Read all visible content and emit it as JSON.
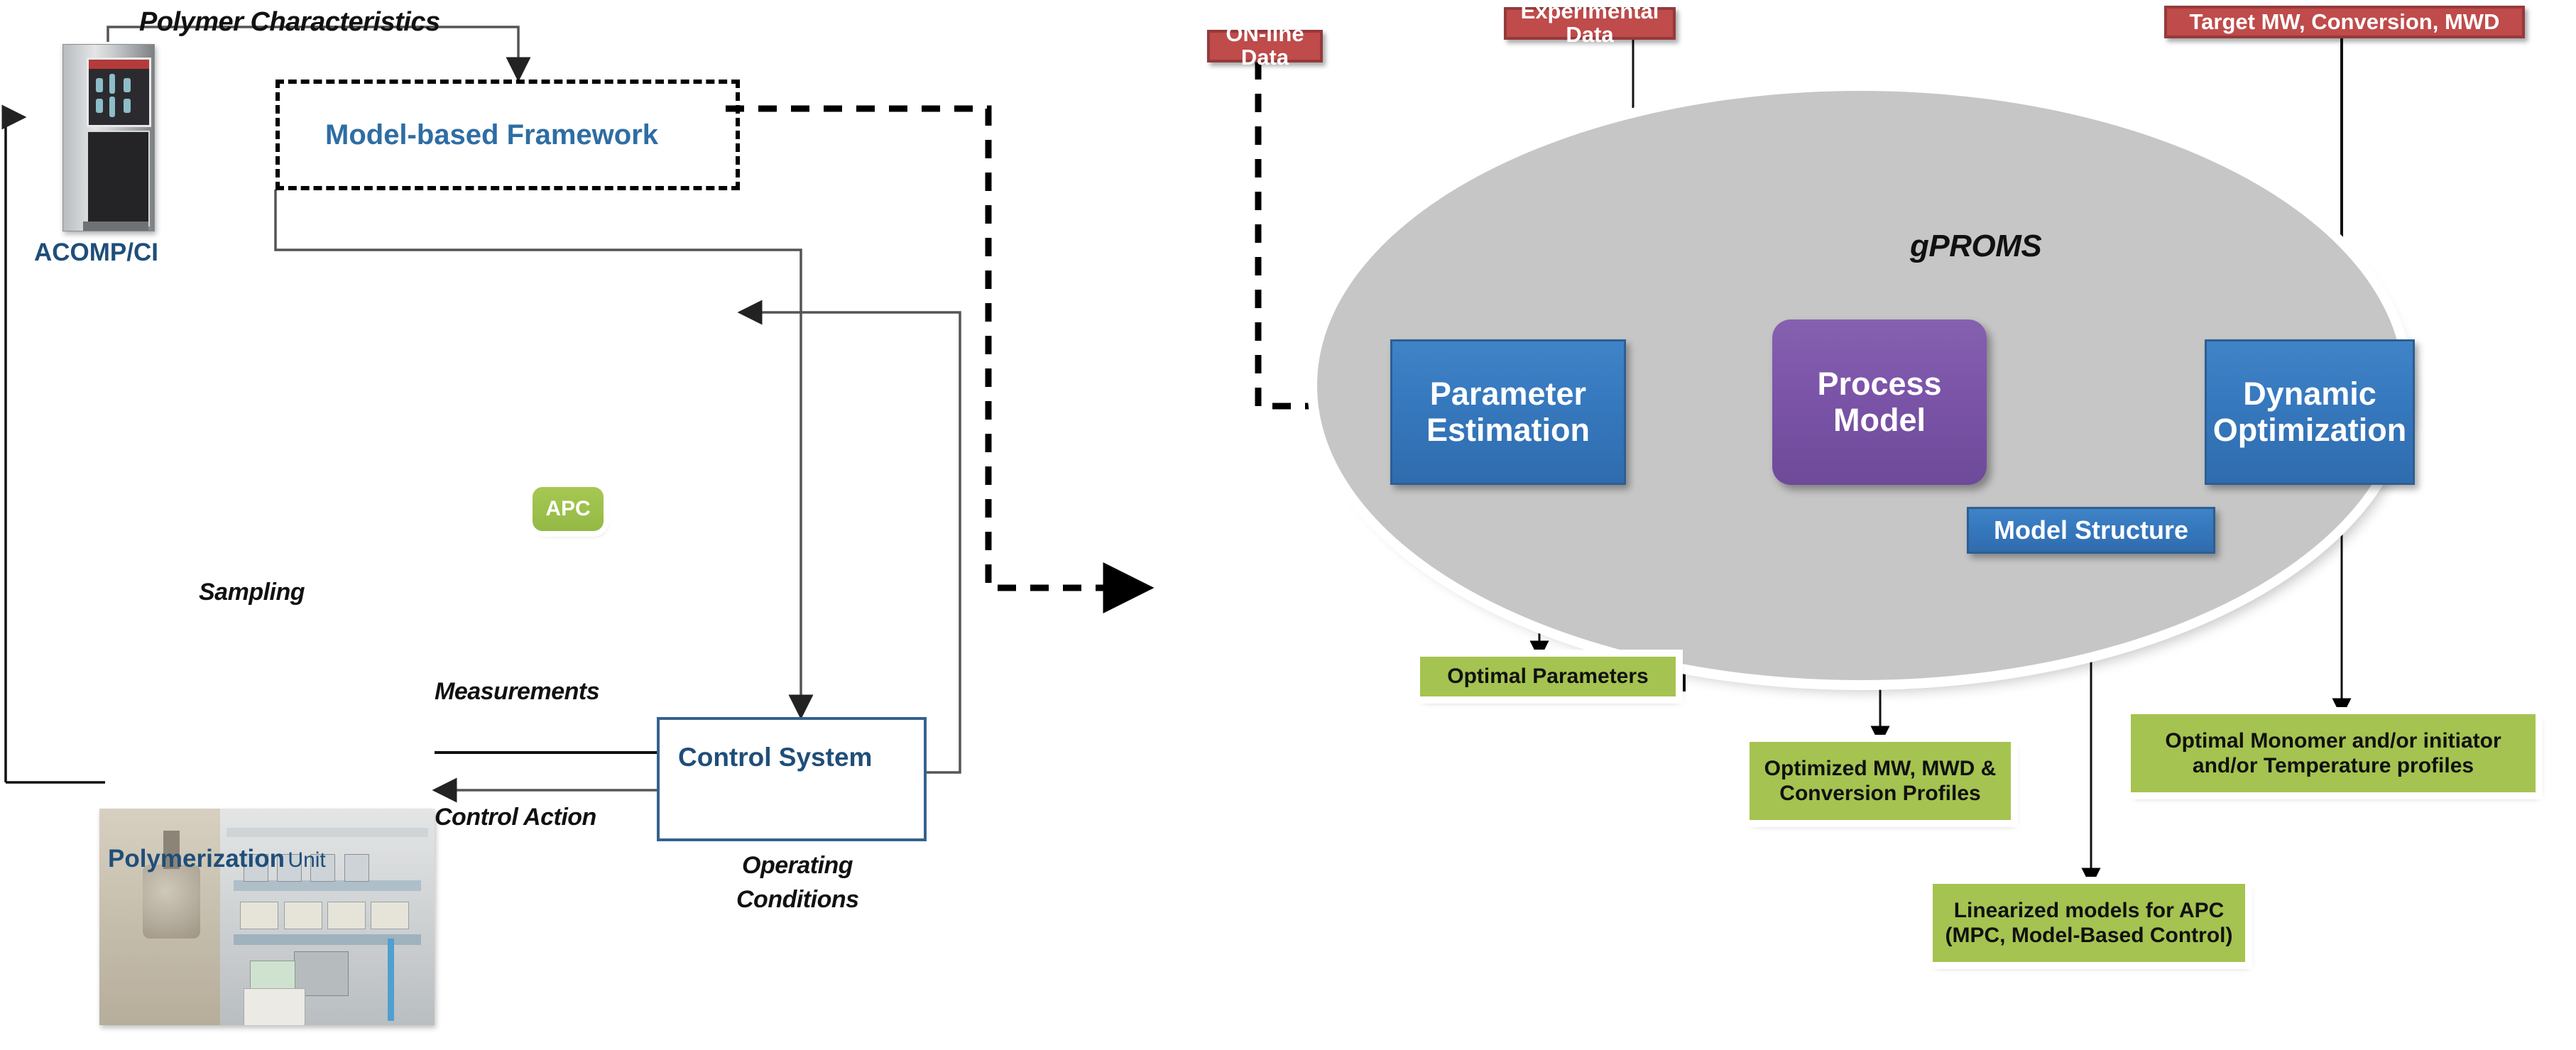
{
  "left": {
    "polymer_characteristics_label": "Polymer Characteristics",
    "acomp_label": "ACOMP/CI",
    "framework_label": "Model-based Framework",
    "apc_label": "APC",
    "sampling_label": "Sampling",
    "measurements_label": "Measurements",
    "control_action_label": "Control Action",
    "control_system_label": "Control System",
    "operating_conditions_line1": "Operating",
    "operating_conditions_line2": "Conditions",
    "polymerization_unit_bold": "Polymerization",
    "polymerization_unit_light": "Unit"
  },
  "right": {
    "online_data_label": "ON-line Data",
    "experimental_data_label": "Experimental Data",
    "target_label": "Target MW, Conversion, MWD",
    "gproms_label": "gPROMS",
    "parameter_estimation_line1": "Parameter",
    "parameter_estimation_line2": "Estimation",
    "process_model_line1": "Process",
    "process_model_line2": "Model",
    "dynamic_optimization_line1": "Dynamic",
    "dynamic_optimization_line2": "Optimization",
    "model_structure_label": "Model Structure",
    "optimal_parameters_label": "Optimal Parameters",
    "optimized_profiles_line1": "Optimized MW, MWD &",
    "optimized_profiles_line2": "Conversion Profiles",
    "linearized_models_line1": "Linearized models for APC",
    "linearized_models_line2": "(MPC, Model-Based Control)",
    "optimal_monomer_line1": "Optimal Monomer and/or initiator",
    "optimal_monomer_line2": "and/or Temperature profiles"
  },
  "colors": {
    "red_box": "#BF4B4B",
    "red_border": "#96393A",
    "blue_box": "#3678BD",
    "purple_box": "#7B54A8",
    "green_box": "#A5C350",
    "ellipse_gray": "#C6C6C6",
    "blue_text": "#1F4E79",
    "framework_text": "#2E6DA4"
  }
}
